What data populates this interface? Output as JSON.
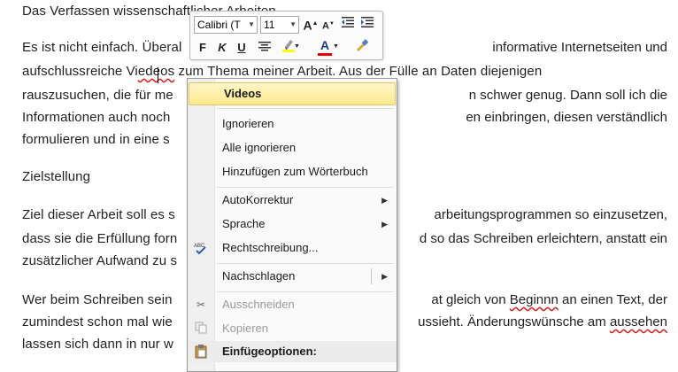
{
  "document": {
    "title_line": "Das Verfassen wissenschaftlicher Arbeiten",
    "p1_l1_a": "Es ist nicht einfach. Überal",
    "p1_l1_b": "informative Internetseiten und",
    "p1_l2_a": "aufschlussreiche Vi",
    "p1_l2_squig": "edeos",
    "p1_l2_b": "zum Thema meiner Arbeit. Aus der Fülle an Daten diejenigen",
    "p1_l3_a": "rauszusuchen,  die für me",
    "p1_l3_b": "n schwer genug. Dann soll ich die",
    "p1_l4_a": "Informationen auch noch",
    "p1_l4_b": "en einbringen,  diesen verständlich",
    "p1_l5_a": "formulieren und in eine s",
    "heading": "Zielstellung",
    "p2_l1_a": "Ziel dieser Arbeit soll es s",
    "p2_l1_b": "arbeitungsprogrammen  so einzusetzen,",
    "p2_l2_a": "dass sie die Erfüllung forn",
    "p2_l2_b": "d so das Schreiben  erleichtern,  anstatt ein",
    "p2_l3_a": "zusätzlicher  Aufwand zu s",
    "p3_l1_a": "Wer beim Schreiben  sein",
    "p3_l1_b": "at gleich von",
    "p3_l1_squig": "Beginnn",
    "p3_l1_c": "an einen Text, der",
    "p3_l2_a": "zumindest  schon mal wie",
    "p3_l2_b": "ussieht.  Änderungswünsche  am",
    "p3_l2_squig": "aussehen",
    "p3_l3_a": "lassen sich dann in nur w"
  },
  "mini_toolbar": {
    "font_name": "Calibri (T",
    "font_size": "11",
    "grow_font": "A",
    "shrink_font": "A",
    "bold": "F",
    "italic": "K",
    "underline": "U",
    "font_color_letter": "A"
  },
  "context_menu": {
    "suggestion": "Videos",
    "ignore": "Ignorieren",
    "ignore_all": "Alle ignorieren",
    "add_to_dictionary": "Hinzufügen zum Wörterbuch",
    "autocorrect": "AutoKorrektur",
    "language": "Sprache",
    "spelling": "Rechtschreibung...",
    "lookup": "Nachschlagen",
    "cut": "Ausschneiden",
    "copy": "Kopieren",
    "paste_options": "Einfügeoptionen:"
  },
  "colors": {
    "highlight": "#ffff00",
    "font_color": "#e00000",
    "menu_highlight": "#fde98c",
    "spell_error": "#d02020"
  }
}
